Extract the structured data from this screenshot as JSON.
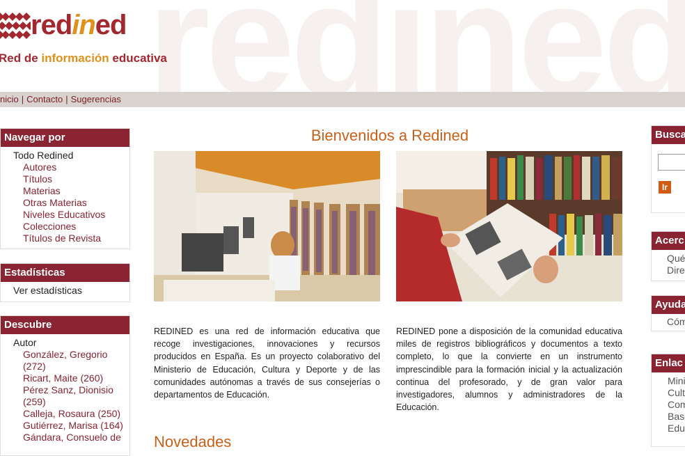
{
  "header": {
    "watermark": "redined",
    "logo_prefix": "red",
    "logo_mid": "in",
    "logo_suffix": "ed",
    "tagline_a": "Red de ",
    "tagline_b": "información",
    "tagline_c": " educativa"
  },
  "topnav": {
    "inicio": "nicio",
    "contacto": "Contacto",
    "sugerencias": "Sugerencias",
    "sep": "|"
  },
  "left": {
    "navegar": {
      "title": "Navegar por",
      "top": "Todo Redined",
      "items": [
        "Autores",
        "Títulos",
        "Materias",
        "Otras Materias",
        "Niveles Educativos",
        "Colecciones",
        "Títulos de Revista"
      ]
    },
    "estadisticas": {
      "title": "Estadísticas",
      "items": [
        "Ver estadísticas"
      ]
    },
    "descubre": {
      "title": "Descubre",
      "group": "Autor",
      "items": [
        "González, Gregorio (272)",
        "Ricart, Maite (260)",
        "Pérez Sanz, Dionisio (259)",
        "Calleja, Rosaura (250)",
        "Gutiérrez, Marisa (164)",
        "Gándara, Consuelo de"
      ]
    }
  },
  "main": {
    "title": "Bienvenidos a Redined",
    "para1": "REDINED es una red de información educativa que recoge investigaciones, innovaciones y recursos producidos en España. Es un proyecto colaborativo del Ministerio de Educación, Cultura y Deporte y de las comunidades autónomas a través de sus consejerías o departamentos de Educación.",
    "para2": "REDINED pone a disposición de la comunidad educativa miles de registros bibliográficos y documentos a texto completo, lo que la convierte en un instrumento imprescindible para la formación inicial y la actualización continua del profesorado, y de gran valor para investigadores, alumnos y administradores de la Educación.",
    "novedades": "Novedades"
  },
  "right": {
    "buscar": {
      "title": "Busca",
      "button": "Ir"
    },
    "acerca": {
      "title": "Acerc",
      "items": [
        "Qué",
        "Dire"
      ]
    },
    "ayuda": {
      "title": "Ayuda",
      "items": [
        "Cóm"
      ]
    },
    "enlaces": {
      "title": "Enlac",
      "items": [
        "Mini",
        "Cult",
        "Com",
        "Base",
        "Edu"
      ]
    }
  },
  "colors": {
    "brand": "#8a2332",
    "accent": "#e0911c",
    "title": "#c8601a"
  }
}
